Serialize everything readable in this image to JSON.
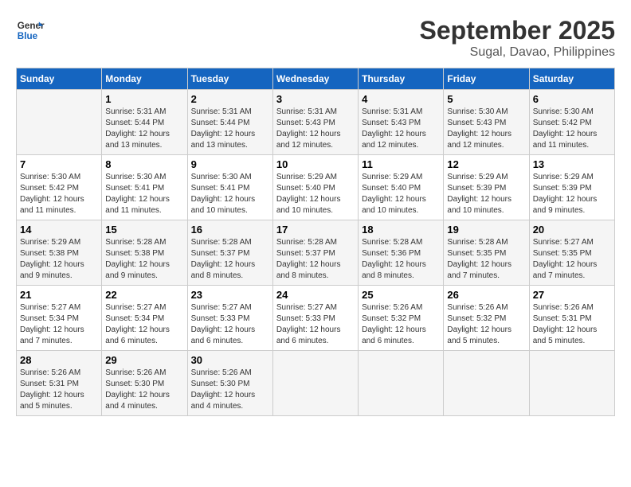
{
  "logo": {
    "text_general": "General",
    "text_blue": "Blue"
  },
  "title": "September 2025",
  "subtitle": "Sugal, Davao, Philippines",
  "days_of_week": [
    "Sunday",
    "Monday",
    "Tuesday",
    "Wednesday",
    "Thursday",
    "Friday",
    "Saturday"
  ],
  "weeks": [
    [
      {
        "day": "",
        "info": ""
      },
      {
        "day": "1",
        "info": "Sunrise: 5:31 AM\nSunset: 5:44 PM\nDaylight: 12 hours\nand 13 minutes."
      },
      {
        "day": "2",
        "info": "Sunrise: 5:31 AM\nSunset: 5:44 PM\nDaylight: 12 hours\nand 13 minutes."
      },
      {
        "day": "3",
        "info": "Sunrise: 5:31 AM\nSunset: 5:43 PM\nDaylight: 12 hours\nand 12 minutes."
      },
      {
        "day": "4",
        "info": "Sunrise: 5:31 AM\nSunset: 5:43 PM\nDaylight: 12 hours\nand 12 minutes."
      },
      {
        "day": "5",
        "info": "Sunrise: 5:30 AM\nSunset: 5:43 PM\nDaylight: 12 hours\nand 12 minutes."
      },
      {
        "day": "6",
        "info": "Sunrise: 5:30 AM\nSunset: 5:42 PM\nDaylight: 12 hours\nand 11 minutes."
      }
    ],
    [
      {
        "day": "7",
        "info": "Sunrise: 5:30 AM\nSunset: 5:42 PM\nDaylight: 12 hours\nand 11 minutes."
      },
      {
        "day": "8",
        "info": "Sunrise: 5:30 AM\nSunset: 5:41 PM\nDaylight: 12 hours\nand 11 minutes."
      },
      {
        "day": "9",
        "info": "Sunrise: 5:30 AM\nSunset: 5:41 PM\nDaylight: 12 hours\nand 10 minutes."
      },
      {
        "day": "10",
        "info": "Sunrise: 5:29 AM\nSunset: 5:40 PM\nDaylight: 12 hours\nand 10 minutes."
      },
      {
        "day": "11",
        "info": "Sunrise: 5:29 AM\nSunset: 5:40 PM\nDaylight: 12 hours\nand 10 minutes."
      },
      {
        "day": "12",
        "info": "Sunrise: 5:29 AM\nSunset: 5:39 PM\nDaylight: 12 hours\nand 10 minutes."
      },
      {
        "day": "13",
        "info": "Sunrise: 5:29 AM\nSunset: 5:39 PM\nDaylight: 12 hours\nand 9 minutes."
      }
    ],
    [
      {
        "day": "14",
        "info": "Sunrise: 5:29 AM\nSunset: 5:38 PM\nDaylight: 12 hours\nand 9 minutes."
      },
      {
        "day": "15",
        "info": "Sunrise: 5:28 AM\nSunset: 5:38 PM\nDaylight: 12 hours\nand 9 minutes."
      },
      {
        "day": "16",
        "info": "Sunrise: 5:28 AM\nSunset: 5:37 PM\nDaylight: 12 hours\nand 8 minutes."
      },
      {
        "day": "17",
        "info": "Sunrise: 5:28 AM\nSunset: 5:37 PM\nDaylight: 12 hours\nand 8 minutes."
      },
      {
        "day": "18",
        "info": "Sunrise: 5:28 AM\nSunset: 5:36 PM\nDaylight: 12 hours\nand 8 minutes."
      },
      {
        "day": "19",
        "info": "Sunrise: 5:28 AM\nSunset: 5:35 PM\nDaylight: 12 hours\nand 7 minutes."
      },
      {
        "day": "20",
        "info": "Sunrise: 5:27 AM\nSunset: 5:35 PM\nDaylight: 12 hours\nand 7 minutes."
      }
    ],
    [
      {
        "day": "21",
        "info": "Sunrise: 5:27 AM\nSunset: 5:34 PM\nDaylight: 12 hours\nand 7 minutes."
      },
      {
        "day": "22",
        "info": "Sunrise: 5:27 AM\nSunset: 5:34 PM\nDaylight: 12 hours\nand 6 minutes."
      },
      {
        "day": "23",
        "info": "Sunrise: 5:27 AM\nSunset: 5:33 PM\nDaylight: 12 hours\nand 6 minutes."
      },
      {
        "day": "24",
        "info": "Sunrise: 5:27 AM\nSunset: 5:33 PM\nDaylight: 12 hours\nand 6 minutes."
      },
      {
        "day": "25",
        "info": "Sunrise: 5:26 AM\nSunset: 5:32 PM\nDaylight: 12 hours\nand 6 minutes."
      },
      {
        "day": "26",
        "info": "Sunrise: 5:26 AM\nSunset: 5:32 PM\nDaylight: 12 hours\nand 5 minutes."
      },
      {
        "day": "27",
        "info": "Sunrise: 5:26 AM\nSunset: 5:31 PM\nDaylight: 12 hours\nand 5 minutes."
      }
    ],
    [
      {
        "day": "28",
        "info": "Sunrise: 5:26 AM\nSunset: 5:31 PM\nDaylight: 12 hours\nand 5 minutes."
      },
      {
        "day": "29",
        "info": "Sunrise: 5:26 AM\nSunset: 5:30 PM\nDaylight: 12 hours\nand 4 minutes."
      },
      {
        "day": "30",
        "info": "Sunrise: 5:26 AM\nSunset: 5:30 PM\nDaylight: 12 hours\nand 4 minutes."
      },
      {
        "day": "",
        "info": ""
      },
      {
        "day": "",
        "info": ""
      },
      {
        "day": "",
        "info": ""
      },
      {
        "day": "",
        "info": ""
      }
    ]
  ]
}
